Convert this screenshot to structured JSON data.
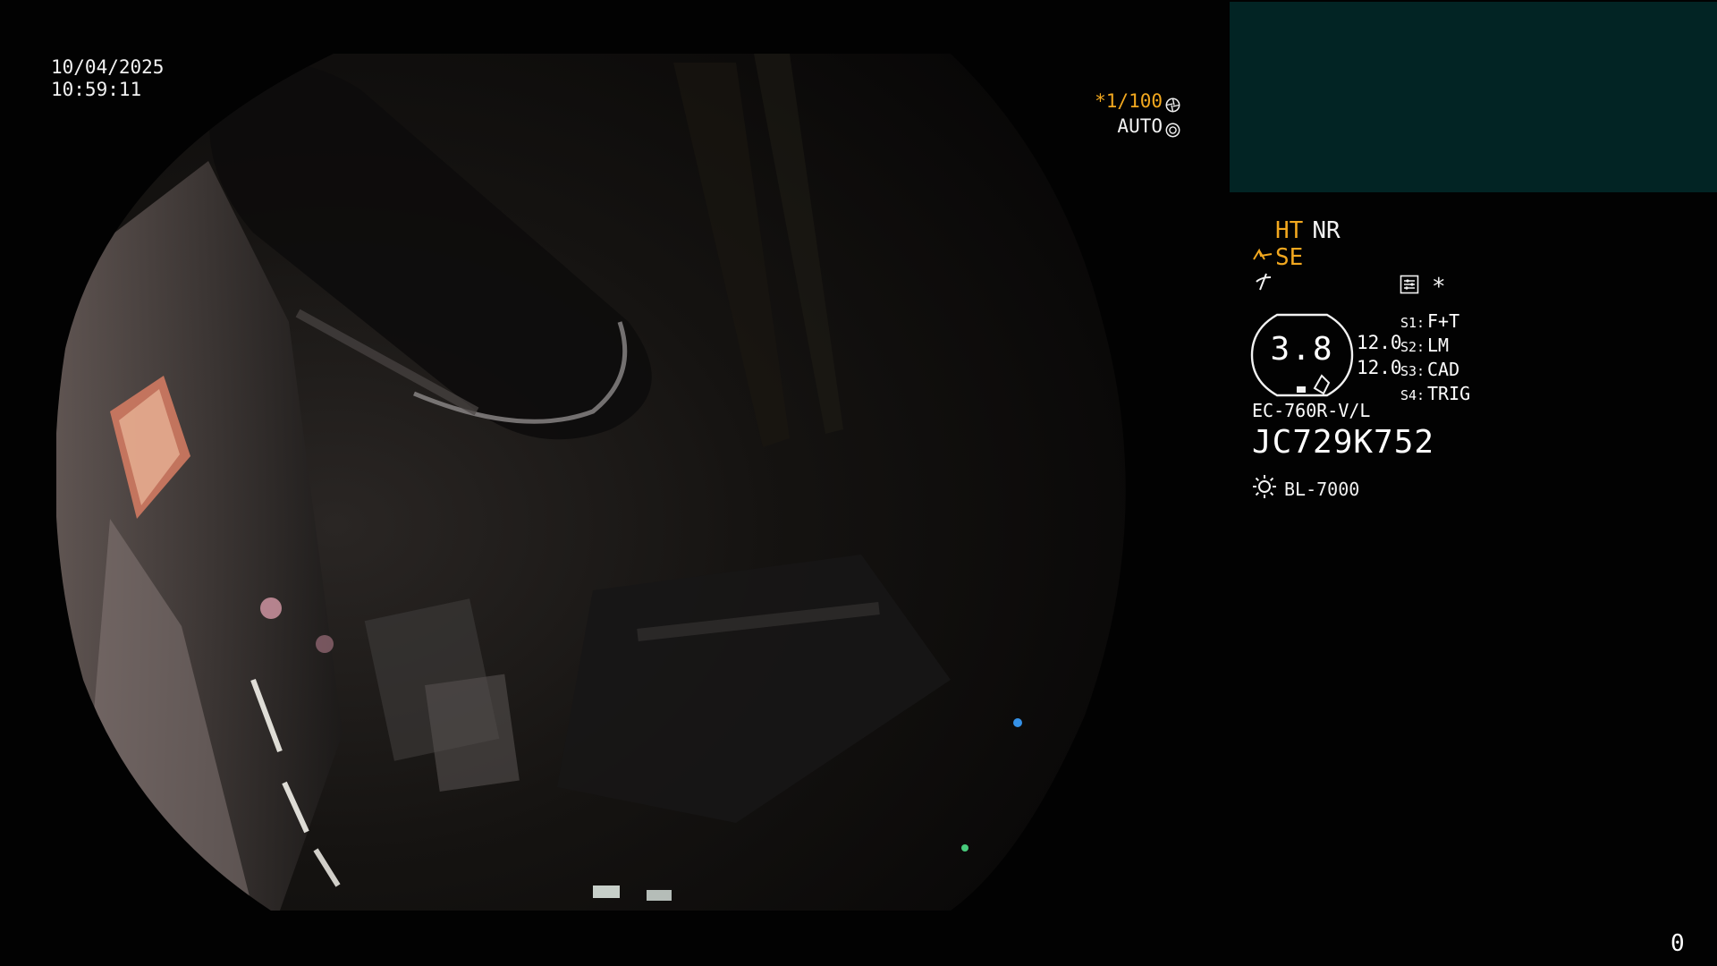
{
  "overlay": {
    "date": "10/04/2025",
    "time": "10:59:11"
  },
  "exposure": {
    "shutter": "*1/100",
    "mode": "AUTO",
    "shutter_color": "#f2a81f"
  },
  "status": {
    "ht": "HT",
    "nr": "NR",
    "se": "SE",
    "star": "*",
    "highlight_color": "#f2a81f"
  },
  "gauge": {
    "value": "3.8",
    "upper": "12.0",
    "lower": "12.0"
  },
  "switches": [
    {
      "key": "S1:",
      "value": "F+T"
    },
    {
      "key": "S2:",
      "value": "LM"
    },
    {
      "key": "S3:",
      "value": "CAD"
    },
    {
      "key": "S4:",
      "value": "TRIG"
    }
  ],
  "scope": {
    "model": "EC-760R-V/L",
    "serial": "JC729K752"
  },
  "light_source": {
    "name": "BL-7000"
  },
  "counter": "0",
  "icons": {
    "shutter": "aperture-icon",
    "auto": "iris-icon",
    "se": "structure-enhance-icon",
    "flash": "flash-icon",
    "record": "record-settings-icon",
    "light": "light-source-icon"
  }
}
